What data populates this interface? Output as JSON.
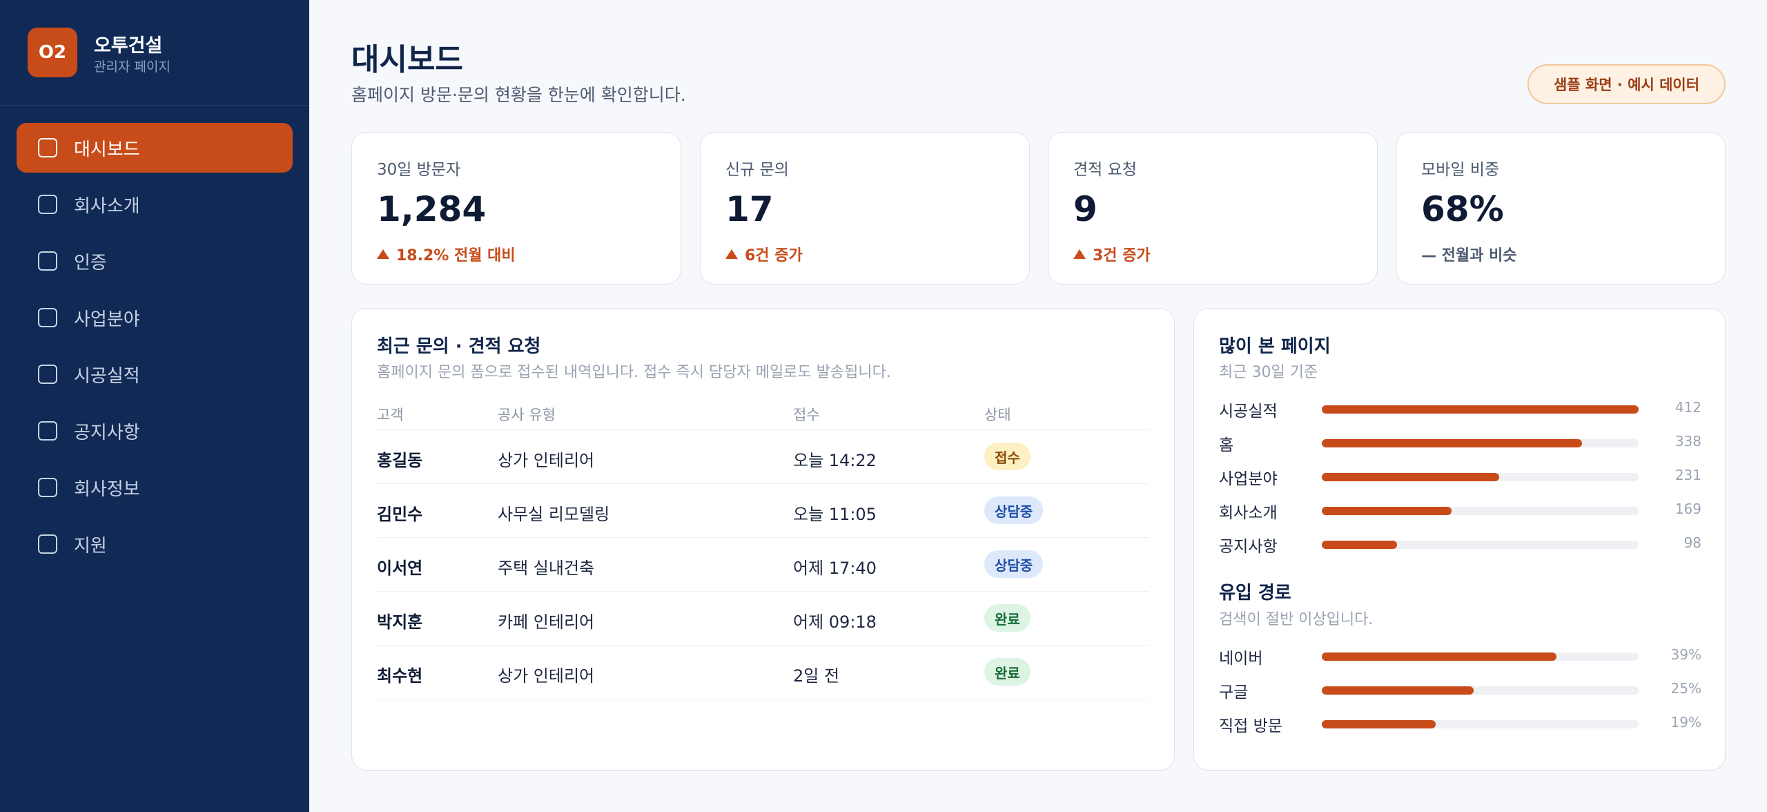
{
  "brand": {
    "logo": "O2",
    "name": "오투건설",
    "subtitle": "관리자 페이지"
  },
  "nav": [
    {
      "label": "대시보드",
      "active": true
    },
    {
      "label": "회사소개",
      "active": false
    },
    {
      "label": "인증",
      "active": false
    },
    {
      "label": "사업분야",
      "active": false
    },
    {
      "label": "시공실적",
      "active": false
    },
    {
      "label": "공지사항",
      "active": false
    },
    {
      "label": "회사정보",
      "active": false
    },
    {
      "label": "지원",
      "active": false
    }
  ],
  "header": {
    "title": "대시보드",
    "subtitle": "홈페이지 방문·문의 현황을 한눈에 확인합니다.",
    "badge": "샘플 화면 · 예시 데이터"
  },
  "stats": [
    {
      "label": "30일 방문자",
      "value": "1,284",
      "delta": "18.2% 전월 대비",
      "trend": "up"
    },
    {
      "label": "신규 문의",
      "value": "17",
      "delta": "6건 증가",
      "trend": "up"
    },
    {
      "label": "견적 요청",
      "value": "9",
      "delta": "3건 증가",
      "trend": "up"
    },
    {
      "label": "모바일 비중",
      "value": "68%",
      "delta": "— 전월과 비슷",
      "trend": "flat"
    }
  ],
  "inquiries": {
    "title": "최근 문의 · 견적 요청",
    "subtitle": "홈페이지 문의 폼으로 접수된 내역입니다. 접수 즉시 담당자 메일로도 발송됩니다.",
    "columns": [
      "고객",
      "공사 유형",
      "접수",
      "상태"
    ],
    "rows": [
      {
        "name": "홍길동",
        "type": "상가 인테리어",
        "time": "오늘 14:22",
        "status": "접수",
        "status_kind": "received"
      },
      {
        "name": "김민수",
        "type": "사무실 리모델링",
        "time": "오늘 11:05",
        "status": "상담중",
        "status_kind": "consult"
      },
      {
        "name": "이서연",
        "type": "주택 실내건축",
        "time": "어제 17:40",
        "status": "상담중",
        "status_kind": "consult"
      },
      {
        "name": "박지훈",
        "type": "카페 인테리어",
        "time": "어제 09:18",
        "status": "완료",
        "status_kind": "done"
      },
      {
        "name": "최수현",
        "type": "상가 인테리어",
        "time": "2일 전",
        "status": "완료",
        "status_kind": "done"
      }
    ]
  },
  "popular": {
    "title": "많이 본 페이지",
    "subtitle": "최근 30일 기준",
    "max": 412,
    "items": [
      {
        "label": "시공실적",
        "value": 412
      },
      {
        "label": "홈",
        "value": 338
      },
      {
        "label": "사업분야",
        "value": 231
      },
      {
        "label": "회사소개",
        "value": 169
      },
      {
        "label": "공지사항",
        "value": 98
      }
    ]
  },
  "traffic": {
    "title": "유입 경로",
    "subtitle": "검색이 절반 이상입니다.",
    "items": [
      {
        "label": "네이버",
        "percent": 39,
        "display": "39%",
        "fill": 0.74
      },
      {
        "label": "구글",
        "percent": 25,
        "display": "25%",
        "fill": 0.48
      },
      {
        "label": "직접 방문",
        "percent": 19,
        "display": "19%",
        "fill": 0.36
      }
    ]
  },
  "colors": {
    "accent": "#c84b1a",
    "sidebar": "#102a55",
    "background": "#f6f8fb"
  },
  "icons": {
    "nav_item": "checkbox-outline-icon",
    "trend_up": "triangle-up-icon"
  }
}
